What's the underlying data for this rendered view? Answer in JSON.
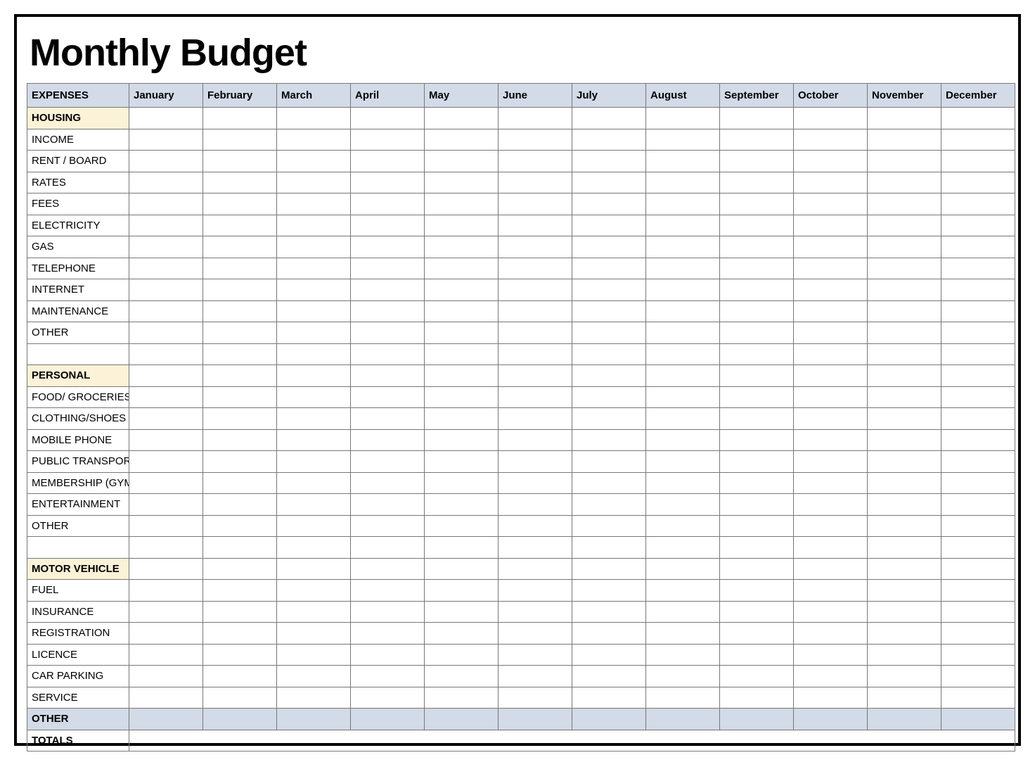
{
  "title": "Monthly Budget",
  "header_label": "EXPENSES",
  "months": [
    "January",
    "February",
    "March",
    "April",
    "May",
    "June",
    "July",
    "August",
    "September",
    "October",
    "November",
    "December"
  ],
  "sections": [
    {
      "name": "HOUSING",
      "style": "cream",
      "items": [
        "INCOME",
        "RENT / BOARD",
        "RATES",
        "FEES",
        "ELECTRICITY",
        "GAS",
        "TELEPHONE",
        "INTERNET",
        "MAINTENANCE",
        "OTHER"
      ],
      "trailing_blank": true
    },
    {
      "name": "PERSONAL",
      "style": "cream",
      "items": [
        "FOOD/ GROCERIES",
        "CLOTHING/SHOES",
        "MOBILE PHONE",
        "PUBLIC TRANSPORT",
        "MEMBERSHIP (GYM)",
        "ENTERTAINMENT",
        "OTHER"
      ],
      "trailing_blank": true
    },
    {
      "name": "MOTOR VEHICLE",
      "style": "cream",
      "items": [
        "FUEL",
        "INSURANCE",
        "REGISTRATION",
        "LICENCE",
        "CAR PARKING",
        "SERVICE"
      ],
      "trailing_blank": false
    },
    {
      "name": "OTHER",
      "style": "blue",
      "items": [],
      "trailing_blank": false
    }
  ],
  "totals_label": "TOTALS"
}
